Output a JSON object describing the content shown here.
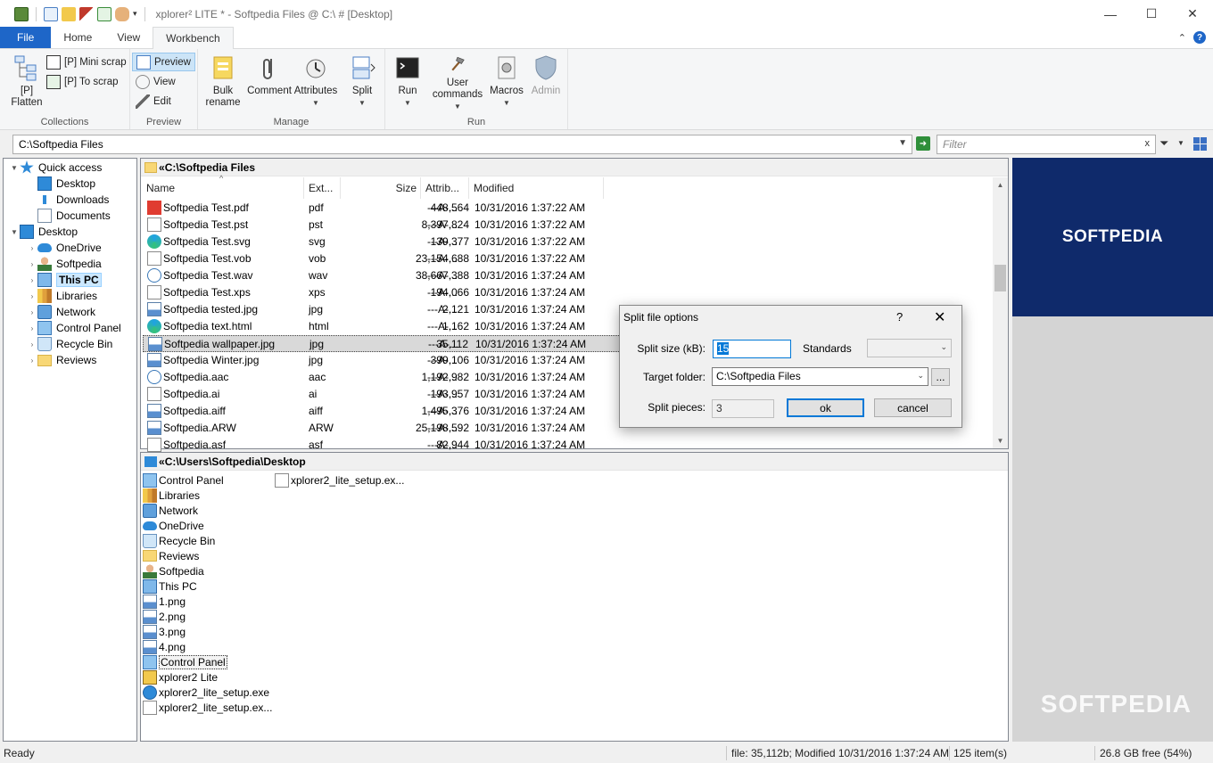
{
  "window": {
    "title": "xplorer² LITE * - Softpedia Files @ C:\\ # [Desktop]",
    "controls": {
      "minimize": "—",
      "maximize": "☐",
      "close": "✕"
    }
  },
  "ribbon_tabs": [
    {
      "label": "File"
    },
    {
      "label": "Home"
    },
    {
      "label": "View"
    },
    {
      "label": "Workbench",
      "active": true
    }
  ],
  "ribbon_right": {
    "collapse": "⌃",
    "help": "?"
  },
  "ribbon": {
    "collections": {
      "label": "Collections",
      "flatten_line1": "[P]",
      "flatten_line2": "Flatten",
      "mini_scrap": "[P] Mini scrap",
      "to_scrap": "[P] To scrap"
    },
    "preview": {
      "label": "Preview",
      "preview": "Preview",
      "view": "View",
      "edit": "Edit"
    },
    "manage": {
      "label": "Manage",
      "bulk_line1": "Bulk",
      "bulk_line2": "rename",
      "comment": "Comment",
      "attributes": "Attributes",
      "split": "Split"
    },
    "run": {
      "label": "Run",
      "run": "Run",
      "user_line1": "User",
      "user_line2": "commands",
      "macros": "Macros",
      "admin": "Admin"
    }
  },
  "address": {
    "path": "C:\\Softpedia Files",
    "filter_placeholder": "Filter"
  },
  "tree": [
    {
      "label": "Quick access",
      "icon": "star-icon",
      "arrow": "▼"
    },
    {
      "label": "Desktop",
      "icon": "desktop-icon"
    },
    {
      "label": "Downloads",
      "icon": "download-icon"
    },
    {
      "label": "Documents",
      "icon": "documents-icon"
    },
    {
      "label": "Desktop",
      "icon": "desktop-icon",
      "arrow": "▼"
    },
    {
      "label": "OneDrive",
      "icon": "cloud-icon",
      "arrow": "›"
    },
    {
      "label": "Softpedia",
      "icon": "user-icon",
      "arrow": "›"
    },
    {
      "label": "This PC",
      "icon": "computer-icon",
      "arrow": "›"
    },
    {
      "label": "Libraries",
      "icon": "library-icon",
      "arrow": "›"
    },
    {
      "label": "Network",
      "icon": "network-icon",
      "arrow": "›"
    },
    {
      "label": "Control Panel",
      "icon": "control-panel-icon",
      "arrow": "›"
    },
    {
      "label": "Recycle Bin",
      "icon": "recycle-bin-icon",
      "arrow": "›"
    },
    {
      "label": "Reviews",
      "icon": "folder-icon",
      "arrow": "›"
    }
  ],
  "main_pane": {
    "path": "C:\\Softpedia Files",
    "columns": {
      "name": "Name",
      "ext": "Ext...",
      "size": "Size",
      "attrib": "Attrib...",
      "modified": "Modified"
    },
    "rows": [
      {
        "name": "Softpedia Test.pdf",
        "ext": "pdf",
        "size": "448,564",
        "attrib": "---A-...",
        "modified": "10/31/2016 1:37:22 AM",
        "icon": "pdf-icon"
      },
      {
        "name": "Softpedia Test.pst",
        "ext": "pst",
        "size": "8,397,824",
        "attrib": "---A-...",
        "modified": "10/31/2016 1:37:22 AM",
        "icon": "file-icon"
      },
      {
        "name": "Softpedia Test.svg",
        "ext": "svg",
        "size": "139,377",
        "attrib": "---A-...",
        "modified": "10/31/2016 1:37:22 AM",
        "icon": "edge-icon"
      },
      {
        "name": "Softpedia Test.vob",
        "ext": "vob",
        "size": "23,154,688",
        "attrib": "---A-...",
        "modified": "10/31/2016 1:37:22 AM",
        "icon": "file-icon"
      },
      {
        "name": "Softpedia Test.wav",
        "ext": "wav",
        "size": "38,667,388",
        "attrib": "---A-...",
        "modified": "10/31/2016 1:37:24 AM",
        "icon": "media-icon"
      },
      {
        "name": "Softpedia Test.xps",
        "ext": "xps",
        "size": "194,066",
        "attrib": "---A-...",
        "modified": "10/31/2016 1:37:24 AM",
        "icon": "file-icon"
      },
      {
        "name": "Softpedia tested.jpg",
        "ext": "jpg",
        "size": "2,121",
        "attrib": "---A-...",
        "modified": "10/31/2016 1:37:24 AM",
        "icon": "image-icon"
      },
      {
        "name": "Softpedia text.html",
        "ext": "html",
        "size": "1,162",
        "attrib": "---A-...",
        "modified": "10/31/2016 1:37:24 AM",
        "icon": "edge-icon"
      },
      {
        "name": "Softpedia wallpaper.jpg",
        "ext": "jpg",
        "size": "35,112",
        "attrib": "---A-...",
        "modified": "10/31/2016 1:37:24 AM",
        "icon": "image-icon",
        "selected": true
      },
      {
        "name": "Softpedia Winter.jpg",
        "ext": "jpg",
        "size": "399,106",
        "attrib": "---A-...",
        "modified": "10/31/2016 1:37:24 AM",
        "icon": "image-icon"
      },
      {
        "name": "Softpedia.aac",
        "ext": "aac",
        "size": "1,192,982",
        "attrib": "---A-...",
        "modified": "10/31/2016 1:37:24 AM",
        "icon": "media-icon"
      },
      {
        "name": "Softpedia.ai",
        "ext": "ai",
        "size": "193,957",
        "attrib": "---A-...",
        "modified": "10/31/2016 1:37:24 AM",
        "icon": "file-icon"
      },
      {
        "name": "Softpedia.aiff",
        "ext": "aiff",
        "size": "1,495,376",
        "attrib": "---A-...",
        "modified": "10/31/2016 1:37:24 AM",
        "icon": "image-icon"
      },
      {
        "name": "Softpedia.ARW",
        "ext": "ARW",
        "size": "25,198,592",
        "attrib": "---A-...",
        "modified": "10/31/2016 1:37:24 AM",
        "icon": "image-icon"
      },
      {
        "name": "Softpedia.asf",
        "ext": "asf",
        "size": "82,944",
        "attrib": "---A-...",
        "modified": "10/31/2016 1:37:24 AM",
        "icon": "file-icon"
      }
    ]
  },
  "bottom_pane": {
    "path": "C:\\Users\\Softpedia\\Desktop",
    "col1": [
      {
        "label": "Control Panel",
        "icon": "control-panel-icon"
      },
      {
        "label": "Libraries",
        "icon": "library-icon"
      },
      {
        "label": "Network",
        "icon": "network-icon"
      },
      {
        "label": "OneDrive",
        "icon": "cloud-icon"
      },
      {
        "label": "Recycle Bin",
        "icon": "recycle-bin-icon"
      },
      {
        "label": "Reviews",
        "icon": "folder-icon"
      },
      {
        "label": "Softpedia",
        "icon": "user-icon"
      },
      {
        "label": "This PC",
        "icon": "computer-icon"
      },
      {
        "label": "1.png",
        "icon": "image-icon"
      },
      {
        "label": "2.png",
        "icon": "image-icon"
      },
      {
        "label": "3.png",
        "icon": "image-icon"
      },
      {
        "label": "4.png",
        "icon": "image-icon"
      },
      {
        "label": "Control Panel",
        "icon": "control-panel-icon",
        "focused": true
      },
      {
        "label": "xplorer2 Lite",
        "icon": "shortcut-icon"
      },
      {
        "label": "xplorer2_lite_setup.exe",
        "icon": "installer-icon"
      },
      {
        "label": "xplorer2_lite_setup.ex...",
        "icon": "file-icon"
      }
    ],
    "col2": [
      {
        "label": "xplorer2_lite_setup.ex...",
        "icon": "file-icon"
      }
    ]
  },
  "preview_pane": {
    "banner_text": "SOFTPEDIA",
    "watermark": "SOFTPEDIA"
  },
  "dialog": {
    "title": "Split file options",
    "help": "?",
    "close": "✕",
    "split_size_label": "Split size (kB):",
    "split_size_value": "15",
    "standards_label": "Standards",
    "standards_value": "",
    "target_label": "Target folder:",
    "target_value": "C:\\Softpedia Files",
    "browse": "...",
    "pieces_label": "Split pieces:",
    "pieces_value": "3",
    "ok": "ok",
    "cancel": "cancel"
  },
  "status": {
    "ready": "Ready",
    "file_info": "file: 35,112b; Modified 10/31/2016 1:37:24 AM",
    "count": "125 item(s)",
    "free": "26.8 GB free (54%)"
  }
}
